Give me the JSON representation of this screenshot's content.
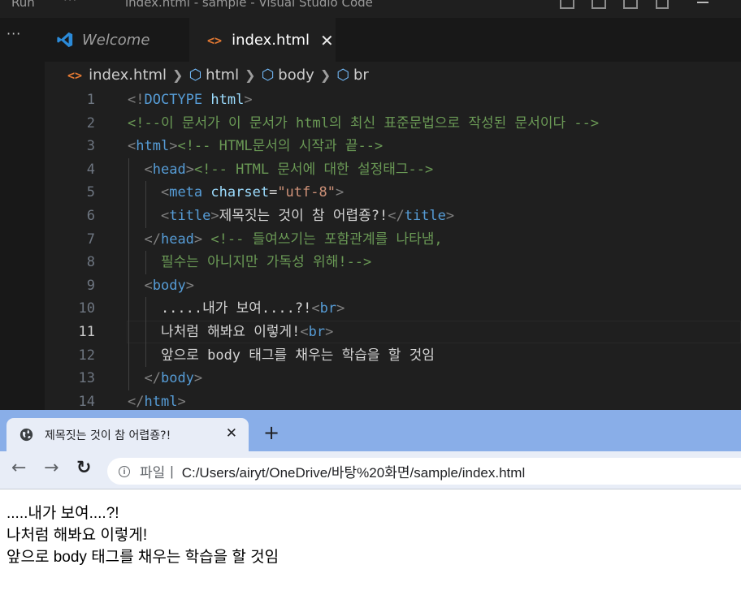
{
  "vscode": {
    "menu_label": "Run",
    "more_label": "···",
    "window_title": "index.html - sample - Visual Studio Code",
    "sidebar_more": "···",
    "tabs": [
      {
        "label": "Welcome",
        "icon": "vscode-logo-icon",
        "active": false
      },
      {
        "label": "index.html",
        "icon": "html-file-icon",
        "active": true,
        "close": "✕"
      }
    ],
    "breadcrumb": [
      "index.html",
      "html",
      "body",
      "br"
    ],
    "active_line": 11,
    "lines": [
      {
        "n": "1",
        "parts": [
          [
            "tg",
            "<!"
          ],
          [
            "tn",
            "DOCTYPE"
          ],
          [
            "pl",
            " "
          ],
          [
            "at",
            "html"
          ],
          [
            "tg",
            ">"
          ]
        ]
      },
      {
        "n": "2",
        "parts": [
          [
            "cm",
            "<!--이 문서가 이 문서가 html의 최신 표준문법으로 작성된 문서이다 -->"
          ]
        ]
      },
      {
        "n": "3",
        "parts": [
          [
            "tg",
            "<"
          ],
          [
            "tn",
            "html"
          ],
          [
            "tg",
            ">"
          ],
          [
            "cm",
            "<!-- HTML문서의 시작과 끝-->"
          ]
        ]
      },
      {
        "n": "4",
        "parts": [
          [
            "pl",
            "  "
          ],
          [
            "tg",
            "<"
          ],
          [
            "tn",
            "head"
          ],
          [
            "tg",
            ">"
          ],
          [
            "cm",
            "<!-- HTML 문서에 대한 설정태그-->"
          ]
        ]
      },
      {
        "n": "5",
        "parts": [
          [
            "pl",
            "    "
          ],
          [
            "tg",
            "<"
          ],
          [
            "tn",
            "meta"
          ],
          [
            "pl",
            " "
          ],
          [
            "at",
            "charset"
          ],
          [
            "pl",
            "="
          ],
          [
            "st",
            "\"utf-8\""
          ],
          [
            "tg",
            ">"
          ]
        ]
      },
      {
        "n": "6",
        "parts": [
          [
            "pl",
            "    "
          ],
          [
            "tg",
            "<"
          ],
          [
            "tn",
            "title"
          ],
          [
            "tg",
            ">"
          ],
          [
            "pl",
            "제목짓는 것이 참 어렵죵?!"
          ],
          [
            "tg",
            "</"
          ],
          [
            "tn",
            "title"
          ],
          [
            "tg",
            ">"
          ]
        ]
      },
      {
        "n": "7",
        "parts": [
          [
            "pl",
            "  "
          ],
          [
            "tg",
            "</"
          ],
          [
            "tn",
            "head"
          ],
          [
            "tg",
            ">"
          ],
          [
            "pl",
            " "
          ],
          [
            "cm",
            "<!-- 들여쓰기는 포함관계를 나타냄,"
          ]
        ]
      },
      {
        "n": "8",
        "parts": [
          [
            "pl",
            "    "
          ],
          [
            "cm",
            "필수는 아니지만 가독성 위해!-->"
          ]
        ]
      },
      {
        "n": "9",
        "parts": [
          [
            "pl",
            "  "
          ],
          [
            "tg",
            "<"
          ],
          [
            "tn",
            "body"
          ],
          [
            "tg",
            ">"
          ]
        ]
      },
      {
        "n": "10",
        "parts": [
          [
            "pl",
            "    .....내가 보여....?!"
          ],
          [
            "tg",
            "<"
          ],
          [
            "tn",
            "br"
          ],
          [
            "tg",
            ">"
          ]
        ]
      },
      {
        "n": "11",
        "parts": [
          [
            "pl",
            "    나처럼 해봐요 이렇게!"
          ],
          [
            "tg",
            "<"
          ],
          [
            "tn",
            "br"
          ],
          [
            "tg",
            ">"
          ]
        ]
      },
      {
        "n": "12",
        "parts": [
          [
            "pl",
            "    앞으로 body 태그를 채우는 학습을 할 것임"
          ]
        ]
      },
      {
        "n": "13",
        "parts": [
          [
            "pl",
            "  "
          ],
          [
            "tg",
            "</"
          ],
          [
            "tn",
            "body"
          ],
          [
            "tg",
            ">"
          ]
        ]
      },
      {
        "n": "14",
        "parts": [
          [
            "tg",
            "</"
          ],
          [
            "tn",
            "html"
          ],
          [
            "tg",
            ">"
          ]
        ]
      }
    ]
  },
  "browser": {
    "tab_title": "제목짓는 것이 참 어렵죵?!",
    "tab_close": "✕",
    "new_tab": "+",
    "back": "←",
    "forward": "→",
    "reload": "↻",
    "info": "i",
    "scheme_label": "파일",
    "url": "C:/Users/airyt/OneDrive/바탕%20화면/sample/index.html",
    "page_lines": [
      ".....내가 보여....?!",
      "나처럼 해봐요 이렇게!",
      "앞으로 body 태그를 채우는 학습을 할 것임"
    ]
  },
  "colors": {
    "editor_bg": "#1f1f1f",
    "tag_name": "#569cd6",
    "attribute": "#9cdcfe",
    "string": "#ce9178",
    "comment": "#6a9955",
    "html_icon": "#e37933",
    "browser_tabstrip": "#89aee8"
  }
}
